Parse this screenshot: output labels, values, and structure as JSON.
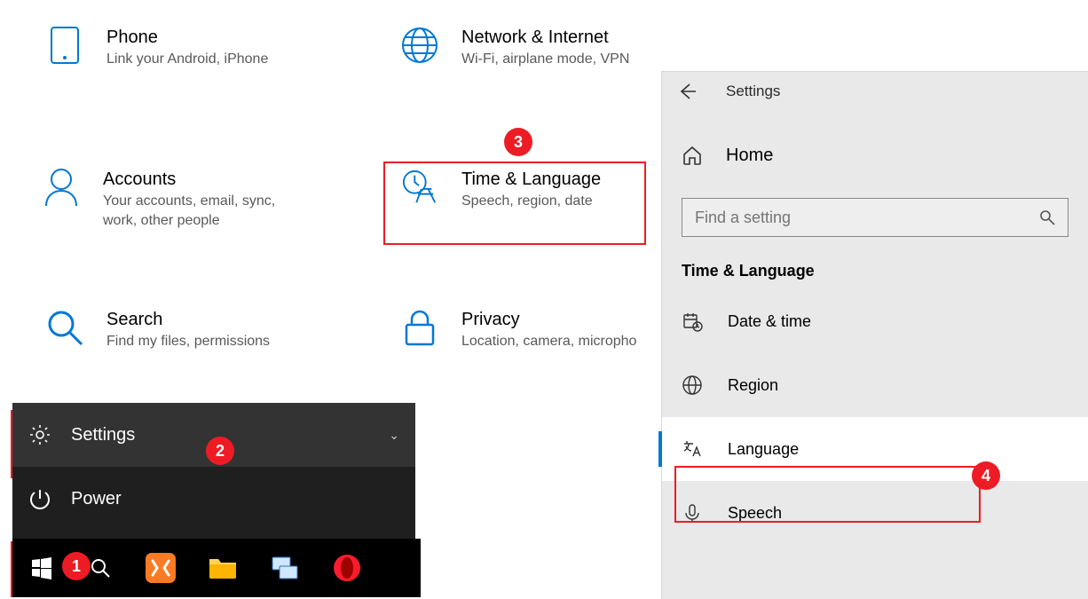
{
  "categories": {
    "phone": {
      "title": "Phone",
      "desc": "Link your Android, iPhone"
    },
    "network": {
      "title": "Network & Internet",
      "desc": "Wi-Fi, airplane mode, VPN"
    },
    "accounts": {
      "title": "Accounts",
      "desc": "Your accounts, email, sync, work, other people"
    },
    "time": {
      "title": "Time & Language",
      "desc": "Speech, region, date"
    },
    "search": {
      "title": "Search",
      "desc": "Find my files, permissions"
    },
    "privacy": {
      "title": "Privacy",
      "desc": "Location, camera, micropho"
    }
  },
  "startmenu": {
    "settings": "Settings",
    "power": "Power"
  },
  "sidebar": {
    "header_title": "Settings",
    "home": "Home",
    "search_placeholder": "Find a setting",
    "section": "Time & Language",
    "items": {
      "datetime": "Date & time",
      "region": "Region",
      "language": "Language",
      "speech": "Speech"
    }
  },
  "badges": {
    "one": "1",
    "two": "2",
    "three": "3",
    "four": "4"
  },
  "colors": {
    "accent": "#0078d4",
    "highlight": "#ed1c24"
  }
}
